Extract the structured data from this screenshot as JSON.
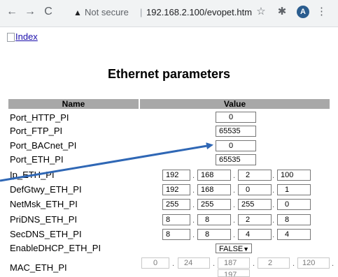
{
  "browser": {
    "back_icon": "←",
    "forward_icon": "→",
    "reload_icon": "C",
    "security_icon": "▲",
    "security_text": "Not secure",
    "separator": "|",
    "url": "192.168.2.100/evopet.htm",
    "bookmark_icon": "☆",
    "extensions_icon": "✱",
    "avatar_letter": "A",
    "menu_icon": "⋮"
  },
  "page": {
    "index_link": "Index",
    "title": "Ethernet parameters",
    "header_name": "Name",
    "header_value": "Value",
    "rows": {
      "port_http": {
        "label": "Port_HTTP_PI",
        "value": "0"
      },
      "port_ftp": {
        "label": "Port_FTP_PI",
        "value": "65535"
      },
      "port_bacnet": {
        "label": "Port_BACnet_PI",
        "value": "0"
      },
      "port_eth": {
        "label": "Port_ETH_PI",
        "value": "65535"
      },
      "ip": {
        "label": "Ip_ETH_PI",
        "values": [
          "192",
          "168",
          "2",
          "100"
        ]
      },
      "gateway": {
        "label": "DefGtwy_ETH_PI",
        "values": [
          "192",
          "168",
          "0",
          "1"
        ]
      },
      "netmask": {
        "label": "NetMsk_ETH_PI",
        "values": [
          "255",
          "255",
          "255",
          "0"
        ]
      },
      "pridns": {
        "label": "PriDNS_ETH_PI",
        "values": [
          "8",
          "8",
          "2",
          "8"
        ]
      },
      "secdns": {
        "label": "SecDNS_ETH_PI",
        "values": [
          "8",
          "8",
          "4",
          "4"
        ]
      },
      "dhcp": {
        "label": "EnableDHCP_ETH_PI",
        "value": "FALSE"
      },
      "mac": {
        "label": "MAC_ETH_PI",
        "values": [
          "0",
          "24",
          "187",
          "2",
          "120",
          "197"
        ]
      }
    },
    "dot": "."
  }
}
